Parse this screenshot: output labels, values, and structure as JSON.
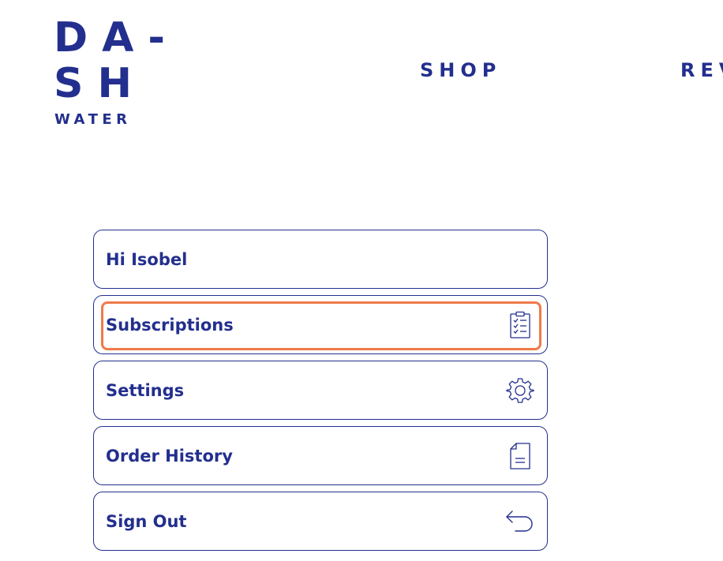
{
  "logo": {
    "line1": "DA-",
    "line2": "SH",
    "subtitle": "WATER"
  },
  "nav": {
    "shop": "SHOP",
    "reviews_partial": "REV"
  },
  "menu": {
    "greeting": "Hi Isobel",
    "items": [
      {
        "label": "Subscriptions",
        "icon": "clipboard-checklist-icon",
        "highlighted": true
      },
      {
        "label": "Settings",
        "icon": "gear-icon"
      },
      {
        "label": "Order History",
        "icon": "document-icon"
      },
      {
        "label": "Sign Out",
        "icon": "return-arrow-icon"
      }
    ]
  },
  "colors": {
    "brand": "#232f8e",
    "highlight": "#f07a4a",
    "background": "#ffffff"
  }
}
